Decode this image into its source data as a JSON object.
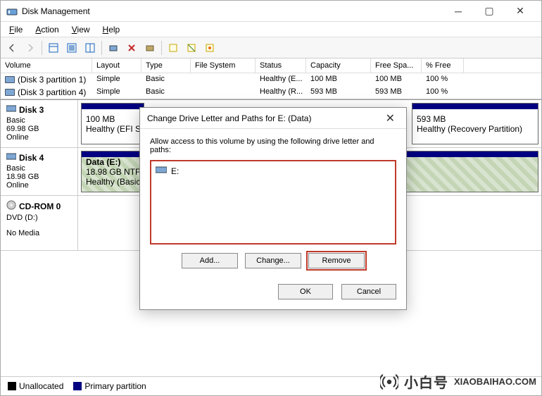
{
  "app": {
    "title": "Disk Management"
  },
  "menus": {
    "file": "File",
    "action": "Action",
    "view": "View",
    "help": "Help"
  },
  "table": {
    "headers": {
      "volume": "Volume",
      "layout": "Layout",
      "type": "Type",
      "fs": "File System",
      "status": "Status",
      "capacity": "Capacity",
      "free": "Free Spa...",
      "pfree": "% Free"
    },
    "rows": [
      {
        "vol": "(Disk 3 partition 1)",
        "layout": "Simple",
        "type": "Basic",
        "fs": "",
        "status": "Healthy (E...",
        "cap": "100 MB",
        "free": "100 MB",
        "pfree": "100 %"
      },
      {
        "vol": "(Disk 3 partition 4)",
        "layout": "Simple",
        "type": "Basic",
        "fs": "",
        "status": "Healthy (R...",
        "cap": "593 MB",
        "free": "593 MB",
        "pfree": "100 %"
      }
    ]
  },
  "disks": {
    "d3": {
      "name": "Disk 3",
      "type": "Basic",
      "size": "69.98 GB",
      "state": "Online",
      "p1": {
        "l1": "100 MB",
        "l2": "Healthy (EFI Sys"
      },
      "p3": {
        "l1": "593 MB",
        "l2": "Healthy (Recovery Partition)"
      }
    },
    "d4": {
      "name": "Disk 4",
      "type": "Basic",
      "size": "18.98 GB",
      "state": "Online",
      "p1": {
        "l0": "Data (E:)",
        "l1": "18.98 GB NTFS",
        "l2": "Healthy (Basic D"
      }
    },
    "cd": {
      "name": "CD-ROM 0",
      "vol": "DVD (D:)",
      "state": "No Media"
    }
  },
  "legend": {
    "unalloc": "Unallocated",
    "prim": "Primary partition"
  },
  "dialog": {
    "title": "Change Drive Letter and Paths for E: (Data)",
    "message": "Allow access to this volume by using the following drive letter and paths:",
    "item": "E:",
    "add": "Add...",
    "change": "Change...",
    "remove": "Remove",
    "ok": "OK",
    "cancel": "Cancel"
  },
  "watermark": {
    "brand": "小白号",
    "url": "XIAOBAIHAO.COM"
  }
}
